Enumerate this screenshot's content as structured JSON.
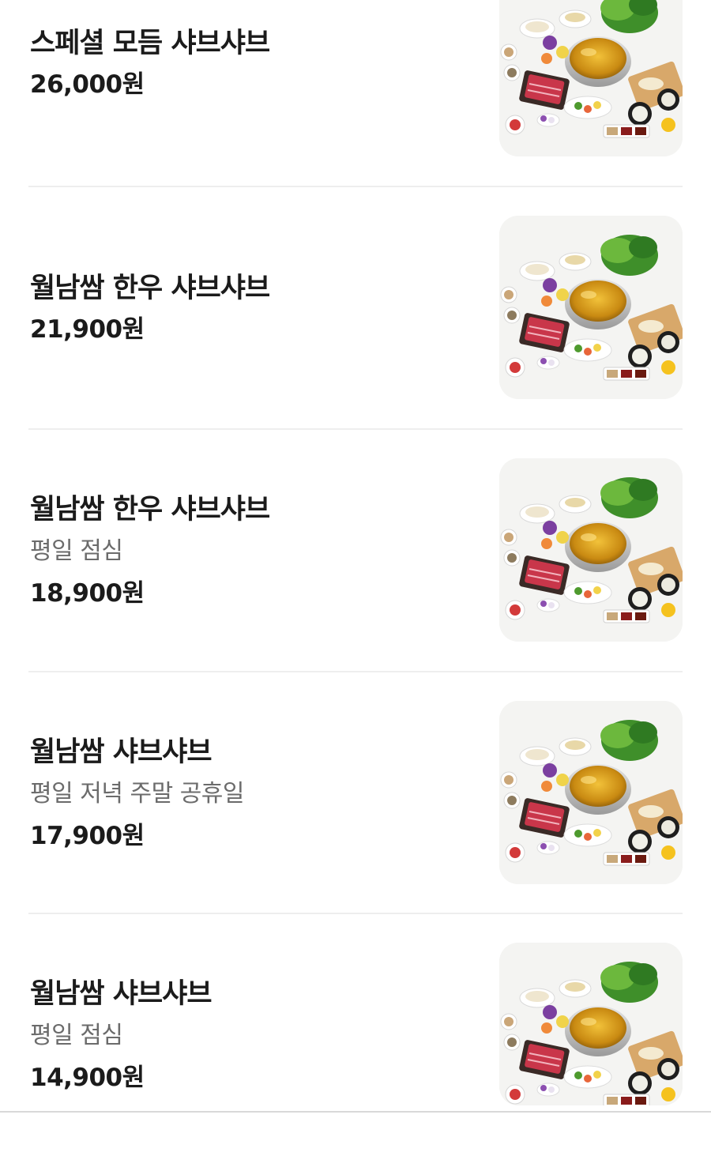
{
  "currency_suffix": "원",
  "menu_items": [
    {
      "name": "스페셜 모듬 샤브샤브",
      "desc": "",
      "price": "26,000원",
      "image_icon": "hotpot-platter-image"
    },
    {
      "name": "월남쌈 한우 샤브샤브",
      "desc": "",
      "price": "21,900원",
      "image_icon": "hotpot-platter-image"
    },
    {
      "name": "월남쌈 한우 샤브샤브",
      "desc": "평일 점심",
      "price": "18,900원",
      "image_icon": "hotpot-platter-image"
    },
    {
      "name": "월남쌈 샤브샤브",
      "desc": "평일 저녁 주말 공휴일",
      "price": "17,900원",
      "image_icon": "hotpot-platter-image"
    },
    {
      "name": "월남쌈 샤브샤브",
      "desc": "평일 점심",
      "price": "14,900원",
      "image_icon": "hotpot-platter-image"
    }
  ],
  "colors": {
    "text_primary": "#1b1b1b",
    "text_secondary": "#6b6b6b",
    "divider": "#eeeeee",
    "background": "#ffffff"
  }
}
